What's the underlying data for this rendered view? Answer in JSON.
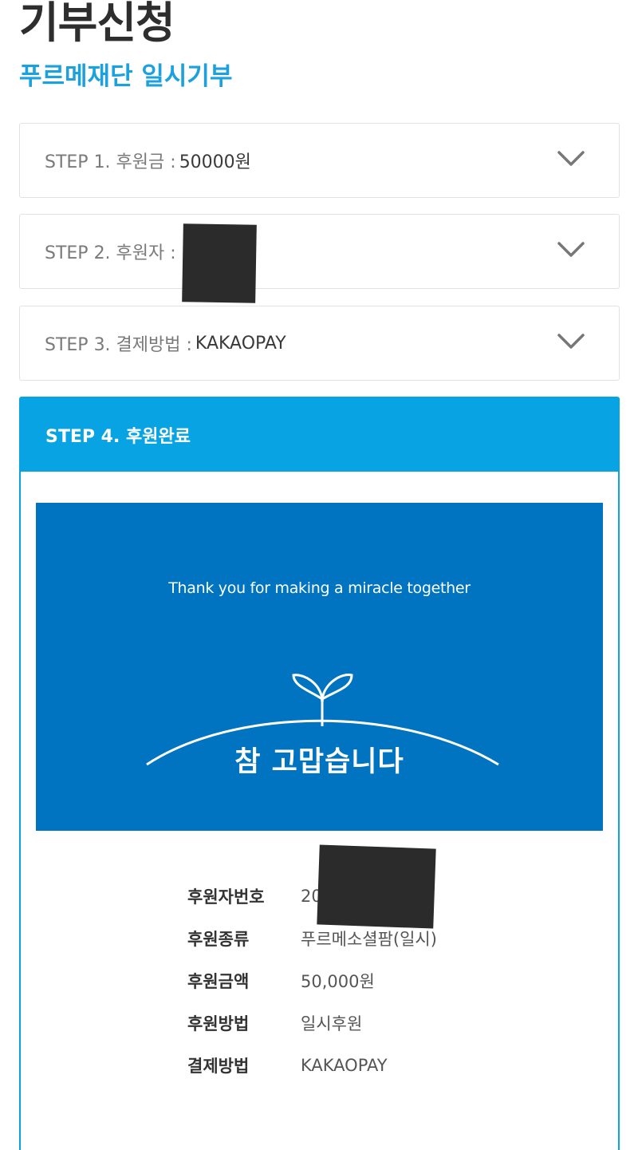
{
  "page": {
    "title": "기부신청",
    "subtitle": "푸르메재단 일시기부"
  },
  "steps": [
    {
      "label": "STEP 1. 후원금 :",
      "value": "50000원"
    },
    {
      "label": "STEP 2. 후원자 :",
      "value": ""
    },
    {
      "label": "STEP 3. 결제방법 :",
      "value": "KAKAOPAY"
    }
  ],
  "step4": {
    "header": "STEP 4. 후원완료",
    "banner": {
      "tagline": "Thank you for making a miracle together",
      "thanks": "참 고맙습니다"
    },
    "info": [
      {
        "label": "후원자번호",
        "value": "20"
      },
      {
        "label": "후원종류",
        "value": "푸르메소셜팜(일시)"
      },
      {
        "label": "후원금액",
        "value": "50,000원"
      },
      {
        "label": "후원방법",
        "value": "일시후원"
      },
      {
        "label": "결제방법",
        "value": "KAKAOPAY"
      }
    ]
  },
  "colors": {
    "accent": "#08a3e2",
    "subtitle": "#1ba1dd",
    "banner": "#0074c0"
  },
  "icons": [
    "chevron-down-icon",
    "sprout-icon"
  ]
}
